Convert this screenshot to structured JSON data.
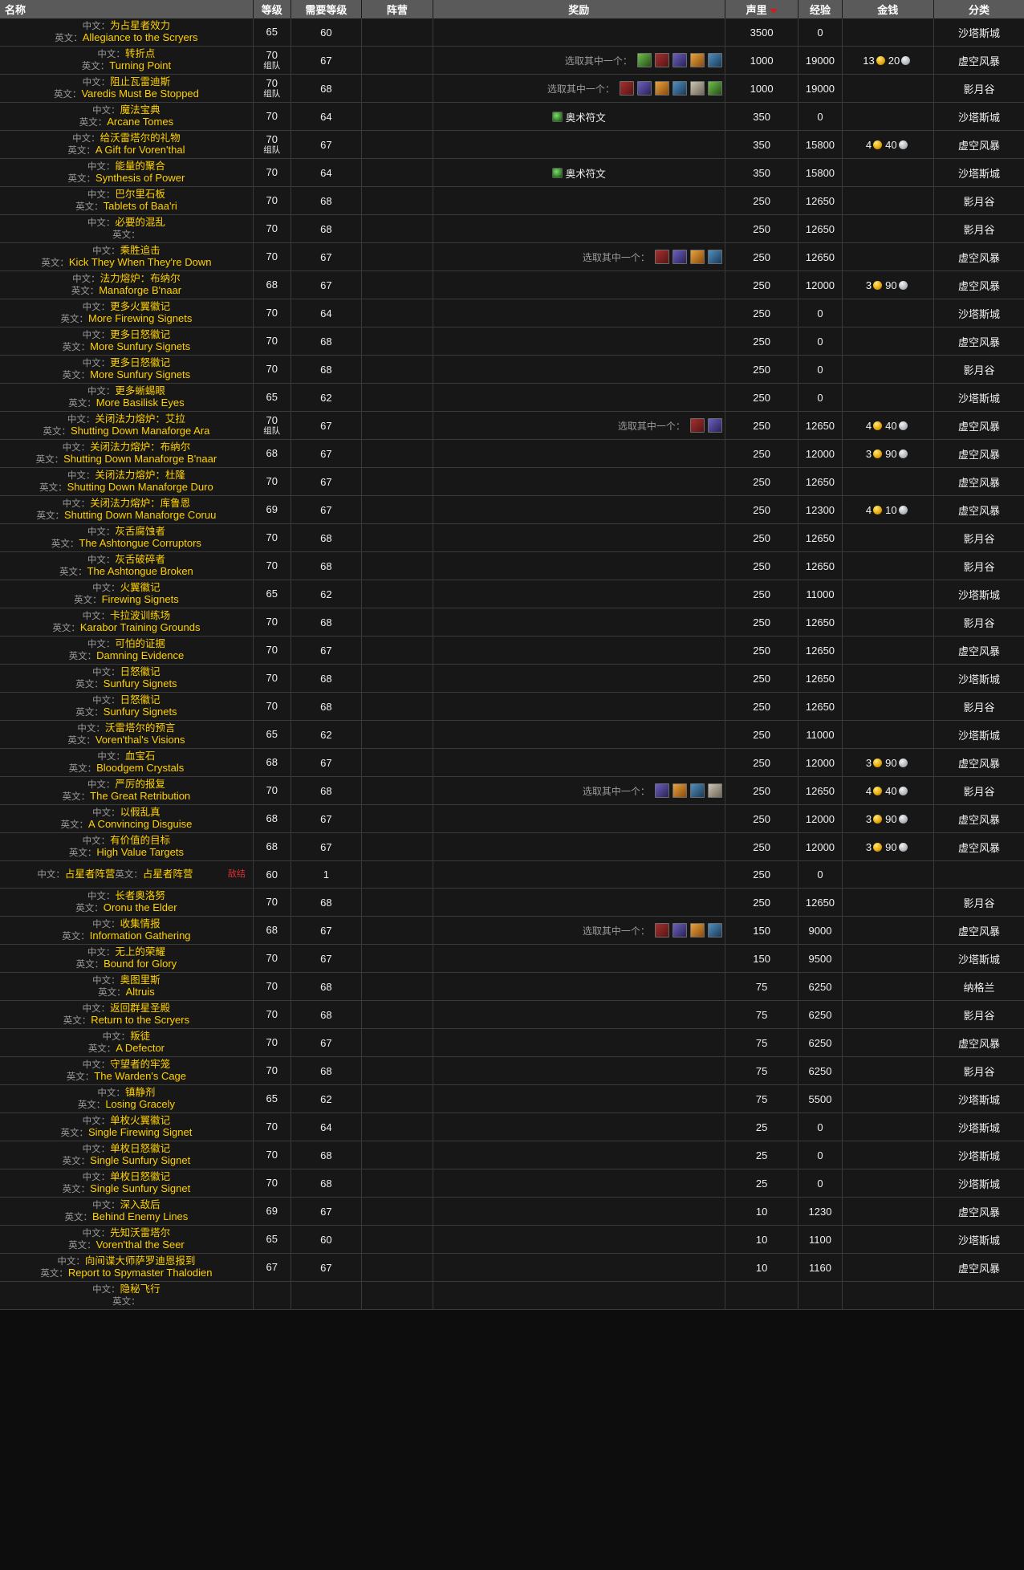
{
  "table": {
    "columns": [
      {
        "key": "name",
        "label": "名称"
      },
      {
        "key": "level",
        "label": "等级"
      },
      {
        "key": "req",
        "label": "需要等级"
      },
      {
        "key": "faction",
        "label": "阵营"
      },
      {
        "key": "reward",
        "label": "奖励"
      },
      {
        "key": "rep",
        "label": "声里",
        "sort": "desc",
        "sort_icon": "sort-desc-arrow-icon"
      },
      {
        "key": "exp",
        "label": "经验"
      },
      {
        "key": "money",
        "label": "金钱"
      },
      {
        "key": "category",
        "label": "分类"
      }
    ],
    "labels": {
      "cn_prefix": "中文：",
      "en_prefix": "英文：",
      "choose_one": "选取其中一个：",
      "group_tag": "组队",
      "hostile_tag": "敌结"
    },
    "colors": {
      "header_bg": "#5a5a5a",
      "quest_name": "#ffd100",
      "row_bg": "#171717",
      "grid": "#3a3a3a",
      "hostile": "#e03030",
      "sort_arrow": "#cc2020"
    },
    "rows": [
      {
        "cn": "为占星者效力",
        "en": "Allegiance to the Scryers",
        "level": "65",
        "sub": "",
        "req": "60",
        "faction": "",
        "reward": {
          "type": "none"
        },
        "rep": "3500",
        "exp": "0",
        "money": null,
        "cat": "沙塔斯城"
      },
      {
        "cn": "转折点",
        "en": "Turning Point",
        "level": "70",
        "sub": "组队",
        "req": "67",
        "faction": "",
        "reward": {
          "type": "choice",
          "count": 5
        },
        "rep": "1000",
        "exp": "19000",
        "money": {
          "gold": "13",
          "silver": "20"
        },
        "cat": "虚空风暴"
      },
      {
        "cn": "阻止瓦雷迪斯",
        "en": "Varedis Must Be Stopped",
        "level": "70",
        "sub": "组队",
        "req": "68",
        "faction": "",
        "reward": {
          "type": "choice",
          "count": 6
        },
        "rep": "1000",
        "exp": "19000",
        "money": null,
        "cat": "影月谷"
      },
      {
        "cn": "魔法宝典",
        "en": "Arcane Tomes",
        "level": "70",
        "sub": "",
        "req": "64",
        "faction": "",
        "reward": {
          "type": "spell",
          "label": "奥术符文"
        },
        "rep": "350",
        "exp": "0",
        "money": null,
        "cat": "沙塔斯城"
      },
      {
        "cn": "给沃雷塔尔的礼物",
        "en": "A Gift for Voren'thal",
        "level": "70",
        "sub": "组队",
        "req": "67",
        "faction": "",
        "reward": {
          "type": "none"
        },
        "rep": "350",
        "exp": "15800",
        "money": {
          "gold": "4",
          "silver": "40"
        },
        "cat": "虚空风暴"
      },
      {
        "cn": "能量的聚合",
        "en": "Synthesis of Power",
        "level": "70",
        "sub": "",
        "req": "64",
        "faction": "",
        "reward": {
          "type": "spell",
          "label": "奥术符文"
        },
        "rep": "350",
        "exp": "15800",
        "money": null,
        "cat": "沙塔斯城"
      },
      {
        "cn": "巴尔里石板",
        "en": "Tablets of Baa'ri",
        "level": "70",
        "sub": "",
        "req": "68",
        "faction": "",
        "reward": {
          "type": "none"
        },
        "rep": "250",
        "exp": "12650",
        "money": null,
        "cat": "影月谷"
      },
      {
        "cn": "必要的混乱",
        "en": "",
        "level": "70",
        "sub": "",
        "req": "68",
        "faction": "",
        "reward": {
          "type": "none"
        },
        "rep": "250",
        "exp": "12650",
        "money": null,
        "cat": "影月谷"
      },
      {
        "cn": "乘胜追击",
        "en": "Kick They When They're Down",
        "level": "70",
        "sub": "",
        "req": "67",
        "faction": "",
        "reward": {
          "type": "choice",
          "count": 4
        },
        "rep": "250",
        "exp": "12650",
        "money": null,
        "cat": "虚空风暴"
      },
      {
        "cn": "法力熔炉：布纳尔",
        "en": "Manaforge B'naar",
        "level": "68",
        "sub": "",
        "req": "67",
        "faction": "",
        "reward": {
          "type": "none"
        },
        "rep": "250",
        "exp": "12000",
        "money": {
          "gold": "3",
          "silver": "90"
        },
        "cat": "虚空风暴"
      },
      {
        "cn": "更多火翼徽记",
        "en": "More Firewing Signets",
        "level": "70",
        "sub": "",
        "req": "64",
        "faction": "",
        "reward": {
          "type": "none"
        },
        "rep": "250",
        "exp": "0",
        "money": null,
        "cat": "沙塔斯城"
      },
      {
        "cn": "更多日怒徽记",
        "en": "More Sunfury Signets",
        "level": "70",
        "sub": "",
        "req": "68",
        "faction": "",
        "reward": {
          "type": "none"
        },
        "rep": "250",
        "exp": "0",
        "money": null,
        "cat": "虚空风暴"
      },
      {
        "cn": "更多日怒徽记",
        "en": "More Sunfury Signets",
        "level": "70",
        "sub": "",
        "req": "68",
        "faction": "",
        "reward": {
          "type": "none"
        },
        "rep": "250",
        "exp": "0",
        "money": null,
        "cat": "影月谷"
      },
      {
        "cn": "更多蜥蜴眼",
        "en": "More Basilisk Eyes",
        "level": "65",
        "sub": "",
        "req": "62",
        "faction": "",
        "reward": {
          "type": "none"
        },
        "rep": "250",
        "exp": "0",
        "money": null,
        "cat": "沙塔斯城"
      },
      {
        "cn": "关闭法力熔炉：艾拉",
        "en": "Shutting Down Manaforge Ara",
        "level": "70",
        "sub": "组队",
        "req": "67",
        "faction": "",
        "reward": {
          "type": "choice",
          "count": 2
        },
        "rep": "250",
        "exp": "12650",
        "money": {
          "gold": "4",
          "silver": "40"
        },
        "cat": "虚空风暴"
      },
      {
        "cn": "关闭法力熔炉：布纳尔",
        "en": "Shutting Down Manaforge B'naar",
        "level": "68",
        "sub": "",
        "req": "67",
        "faction": "",
        "reward": {
          "type": "none"
        },
        "rep": "250",
        "exp": "12000",
        "money": {
          "gold": "3",
          "silver": "90"
        },
        "cat": "虚空风暴"
      },
      {
        "cn": "关闭法力熔炉：杜隆",
        "en": "Shutting Down Manaforge Duro",
        "level": "70",
        "sub": "",
        "req": "67",
        "faction": "",
        "reward": {
          "type": "none"
        },
        "rep": "250",
        "exp": "12650",
        "money": null,
        "cat": "虚空风暴"
      },
      {
        "cn": "关闭法力熔炉：库鲁恩",
        "en": "Shutting Down Manaforge Coruu",
        "level": "69",
        "sub": "",
        "req": "67",
        "faction": "",
        "reward": {
          "type": "none"
        },
        "rep": "250",
        "exp": "12300",
        "money": {
          "gold": "4",
          "silver": "10"
        },
        "cat": "虚空风暴"
      },
      {
        "cn": "灰舌腐蚀者",
        "en": "The Ashtongue Corruptors",
        "level": "70",
        "sub": "",
        "req": "68",
        "faction": "",
        "reward": {
          "type": "none"
        },
        "rep": "250",
        "exp": "12650",
        "money": null,
        "cat": "影月谷"
      },
      {
        "cn": "灰舌破碎者",
        "en": "The Ashtongue Broken",
        "level": "70",
        "sub": "",
        "req": "68",
        "faction": "",
        "reward": {
          "type": "none"
        },
        "rep": "250",
        "exp": "12650",
        "money": null,
        "cat": "影月谷"
      },
      {
        "cn": "火翼徽记",
        "en": "Firewing Signets",
        "level": "65",
        "sub": "",
        "req": "62",
        "faction": "",
        "reward": {
          "type": "none"
        },
        "rep": "250",
        "exp": "11000",
        "money": null,
        "cat": "沙塔斯城"
      },
      {
        "cn": "卡拉波训练场",
        "en": "Karabor Training Grounds",
        "level": "70",
        "sub": "",
        "req": "68",
        "faction": "",
        "reward": {
          "type": "none"
        },
        "rep": "250",
        "exp": "12650",
        "money": null,
        "cat": "影月谷"
      },
      {
        "cn": "可怕的证据",
        "en": "Damning Evidence",
        "level": "70",
        "sub": "",
        "req": "67",
        "faction": "",
        "reward": {
          "type": "none"
        },
        "rep": "250",
        "exp": "12650",
        "money": null,
        "cat": "虚空风暴"
      },
      {
        "cn": "日怒徽记",
        "en": "Sunfury Signets",
        "level": "70",
        "sub": "",
        "req": "68",
        "faction": "",
        "reward": {
          "type": "none"
        },
        "rep": "250",
        "exp": "12650",
        "money": null,
        "cat": "沙塔斯城"
      },
      {
        "cn": "日怒徽记",
        "en": "Sunfury Signets",
        "level": "70",
        "sub": "",
        "req": "68",
        "faction": "",
        "reward": {
          "type": "none"
        },
        "rep": "250",
        "exp": "12650",
        "money": null,
        "cat": "影月谷"
      },
      {
        "cn": "沃雷塔尔的预言",
        "en": "Voren'thal's Visions",
        "level": "65",
        "sub": "",
        "req": "62",
        "faction": "",
        "reward": {
          "type": "none"
        },
        "rep": "250",
        "exp": "11000",
        "money": null,
        "cat": "沙塔斯城"
      },
      {
        "cn": "血宝石",
        "en": "Bloodgem Crystals",
        "level": "68",
        "sub": "",
        "req": "67",
        "faction": "",
        "reward": {
          "type": "none"
        },
        "rep": "250",
        "exp": "12000",
        "money": {
          "gold": "3",
          "silver": "90"
        },
        "cat": "虚空风暴"
      },
      {
        "cn": "严厉的报复",
        "en": "The Great Retribution",
        "level": "70",
        "sub": "",
        "req": "68",
        "faction": "",
        "reward": {
          "type": "choice",
          "count": 4
        },
        "rep": "250",
        "exp": "12650",
        "money": {
          "gold": "4",
          "silver": "40"
        },
        "cat": "影月谷"
      },
      {
        "cn": "以假乱真",
        "en": "A Convincing Disguise",
        "level": "68",
        "sub": "",
        "req": "67",
        "faction": "",
        "reward": {
          "type": "none"
        },
        "rep": "250",
        "exp": "12000",
        "money": {
          "gold": "3",
          "silver": "90"
        },
        "cat": "虚空风暴"
      },
      {
        "cn": "有价值的目标",
        "en": "High Value Targets",
        "level": "68",
        "sub": "",
        "req": "67",
        "faction": "",
        "reward": {
          "type": "none"
        },
        "rep": "250",
        "exp": "12000",
        "money": {
          "gold": "3",
          "silver": "90"
        },
        "cat": "虚空风暴"
      },
      {
        "cn": "占星者阵营",
        "en": "占星者阵营",
        "inline": true,
        "hostile": "敌结",
        "level": "60",
        "sub": "",
        "req": "1",
        "faction": "",
        "reward": {
          "type": "none"
        },
        "rep": "250",
        "exp": "0",
        "money": null,
        "cat": ""
      },
      {
        "cn": "长者奥洛努",
        "en": "Oronu the Elder",
        "level": "70",
        "sub": "",
        "req": "68",
        "faction": "",
        "reward": {
          "type": "none"
        },
        "rep": "250",
        "exp": "12650",
        "money": null,
        "cat": "影月谷"
      },
      {
        "cn": "收集情报",
        "en": "Information Gathering",
        "level": "68",
        "sub": "",
        "req": "67",
        "faction": "",
        "reward": {
          "type": "choice",
          "count": 4
        },
        "rep": "150",
        "exp": "9000",
        "money": null,
        "cat": "虚空风暴"
      },
      {
        "cn": "无上的荣耀",
        "en": "Bound for Glory",
        "level": "70",
        "sub": "",
        "req": "67",
        "faction": "",
        "reward": {
          "type": "none"
        },
        "rep": "150",
        "exp": "9500",
        "money": null,
        "cat": "沙塔斯城"
      },
      {
        "cn": "奥图里斯",
        "en": "Altruis",
        "level": "70",
        "sub": "",
        "req": "68",
        "faction": "",
        "reward": {
          "type": "none"
        },
        "rep": "75",
        "exp": "6250",
        "money": null,
        "cat": "纳格兰"
      },
      {
        "cn": "返回群星圣殿",
        "en": "Return to the Scryers",
        "level": "70",
        "sub": "",
        "req": "68",
        "faction": "",
        "reward": {
          "type": "none"
        },
        "rep": "75",
        "exp": "6250",
        "money": null,
        "cat": "影月谷"
      },
      {
        "cn": "叛徒",
        "en": "A Defector",
        "level": "70",
        "sub": "",
        "req": "67",
        "faction": "",
        "reward": {
          "type": "none"
        },
        "rep": "75",
        "exp": "6250",
        "money": null,
        "cat": "虚空风暴"
      },
      {
        "cn": "守望者的牢笼",
        "en": "The Warden's Cage",
        "level": "70",
        "sub": "",
        "req": "68",
        "faction": "",
        "reward": {
          "type": "none"
        },
        "rep": "75",
        "exp": "6250",
        "money": null,
        "cat": "影月谷"
      },
      {
        "cn": "镇静剂",
        "en": "Losing Gracely",
        "level": "65",
        "sub": "",
        "req": "62",
        "faction": "",
        "reward": {
          "type": "none"
        },
        "rep": "75",
        "exp": "5500",
        "money": null,
        "cat": "沙塔斯城"
      },
      {
        "cn": "单枚火翼徽记",
        "en": "Single Firewing Signet",
        "level": "70",
        "sub": "",
        "req": "64",
        "faction": "",
        "reward": {
          "type": "none"
        },
        "rep": "25",
        "exp": "0",
        "money": null,
        "cat": "沙塔斯城"
      },
      {
        "cn": "单枚日怒徽记",
        "en": "Single Sunfury Signet",
        "level": "70",
        "sub": "",
        "req": "68",
        "faction": "",
        "reward": {
          "type": "none"
        },
        "rep": "25",
        "exp": "0",
        "money": null,
        "cat": "沙塔斯城"
      },
      {
        "cn": "单枚日怒徽记",
        "en": "Single Sunfury Signet",
        "level": "70",
        "sub": "",
        "req": "68",
        "faction": "",
        "reward": {
          "type": "none"
        },
        "rep": "25",
        "exp": "0",
        "money": null,
        "cat": "沙塔斯城"
      },
      {
        "cn": "深入敌后",
        "en": "Behind Enemy Lines",
        "level": "69",
        "sub": "",
        "req": "67",
        "faction": "",
        "reward": {
          "type": "none"
        },
        "rep": "10",
        "exp": "1230",
        "money": null,
        "cat": "虚空风暴"
      },
      {
        "cn": "先知沃雷塔尔",
        "en": "Voren'thal the Seer",
        "level": "65",
        "sub": "",
        "req": "60",
        "faction": "",
        "reward": {
          "type": "none"
        },
        "rep": "10",
        "exp": "1100",
        "money": null,
        "cat": "沙塔斯城"
      },
      {
        "cn": "向间谍大师萨罗迪恩报到",
        "en": "Report to Spymaster Thalodien",
        "level": "67",
        "sub": "",
        "req": "67",
        "faction": "",
        "reward": {
          "type": "none"
        },
        "rep": "10",
        "exp": "1160",
        "money": null,
        "cat": "虚空风暴"
      },
      {
        "cn": "隐秘飞行",
        "en": "",
        "level": "",
        "sub": "",
        "req": "",
        "faction": "",
        "reward": {
          "type": "none"
        },
        "rep": "",
        "exp": "",
        "money": null,
        "cat": ""
      }
    ]
  }
}
